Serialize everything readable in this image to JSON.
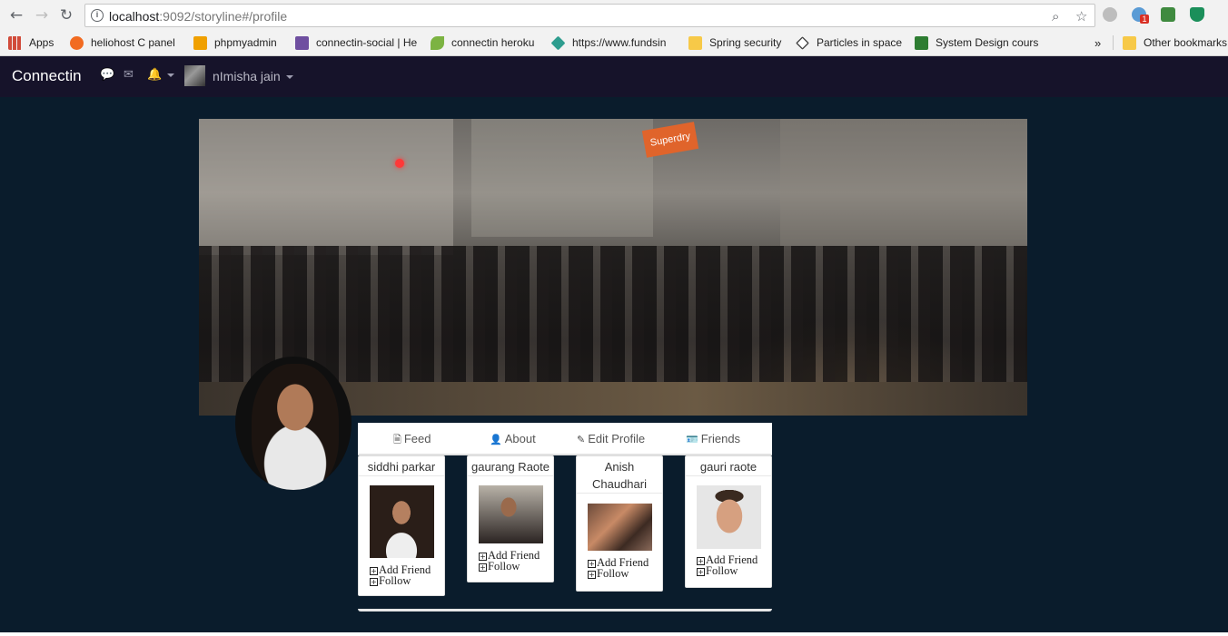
{
  "browser": {
    "url_host": "localhost",
    "url_rest": ":9092/storyline#/profile",
    "ext_badge": "1",
    "bookmarks": [
      {
        "label": "Apps",
        "color": "#d14b3a"
      },
      {
        "label": "heliohost C panel",
        "color": "#f26b21"
      },
      {
        "label": "phpmyadmin",
        "color": "#f0a000"
      },
      {
        "label": "connectin-social | He",
        "color": "#6f4fa0"
      },
      {
        "label": "connectin heroku",
        "color": "#7cb342"
      },
      {
        "label": "https://www.fundsin",
        "color": "#2e9d8f"
      },
      {
        "label": "Spring security",
        "color": "#f7c948"
      },
      {
        "label": "Particles in space",
        "color": "#444444"
      },
      {
        "label": "System Design cours",
        "color": "#2e7d32"
      }
    ],
    "overflow": "»",
    "other_bookmarks": "Other bookmarks"
  },
  "navbar": {
    "brand": "Connectin",
    "user_name": "nImisha jain"
  },
  "tabs": [
    {
      "icon": "🗎",
      "label": "Feed"
    },
    {
      "icon": "👤",
      "label": "About"
    },
    {
      "icon": "✎",
      "label": "Edit Profile"
    },
    {
      "icon": "🪪",
      "label": "Friends"
    }
  ],
  "friends": [
    {
      "name": "siddhi parkar",
      "add": "Add Friend",
      "follow": "Follow"
    },
    {
      "name": "gaurang Raote",
      "add": "Add Friend",
      "follow": "Follow"
    },
    {
      "name": "Anish Chaudhari",
      "add": "Add Friend",
      "follow": "Follow"
    },
    {
      "name": "gauri raote",
      "add": "Add Friend",
      "follow": "Follow"
    }
  ],
  "cover_sign": "Superdry"
}
